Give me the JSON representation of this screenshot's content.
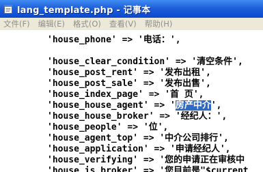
{
  "window": {
    "title": "lang_template.php - 记事本",
    "icon": "notepad-icon"
  },
  "menu": [
    "文件(F)",
    "编辑(E)",
    "格式(O)",
    "查看(V)",
    "帮助(H)"
  ],
  "lines": [
    {
      "text": "'house_phone' => '电话：',"
    },
    {
      "text": ""
    },
    {
      "text": "'house_clear_condition' => '清空条件',"
    },
    {
      "text": "'house_post_rent' => '发布出租',"
    },
    {
      "text": "'house_post_sale' => '发布出售',"
    },
    {
      "text": "'house_index_page' => '首 页',"
    },
    {
      "pre": "'house_house_agent' => '",
      "sel": "房产中介",
      "post": "',"
    },
    {
      "text": "'house_house_broker' => '经纪人：',"
    },
    {
      "text": "'house_people' => '位',"
    },
    {
      "text": "'house_agent_top' => '中介公司排行',"
    },
    {
      "text": "'house_application' => '申请经纪人',"
    },
    {
      "text": "'house_verifying' => '您的申请正在审核中"
    },
    {
      "text": "'house_is_broker' => '您目前是\"$current"
    }
  ]
}
